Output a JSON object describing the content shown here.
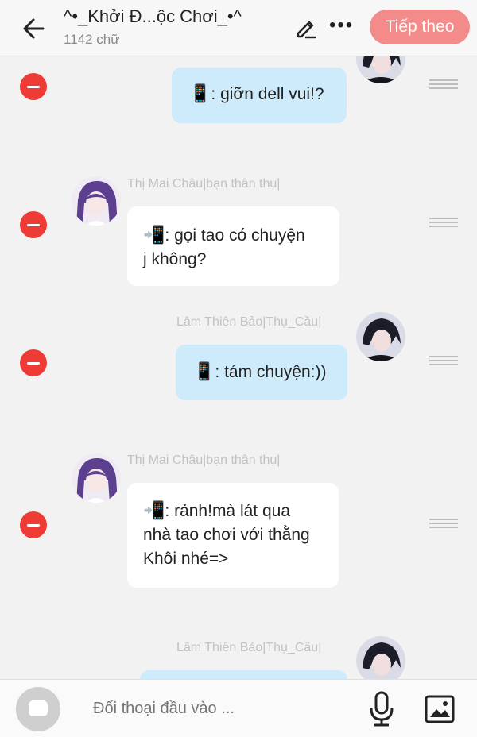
{
  "header": {
    "title": "^•_Khởi Đ...ộc Chơi_•^",
    "word_count": "1142 chữ",
    "next_button": "Tiếp theo"
  },
  "messages": [
    {
      "sender": "",
      "side": "me",
      "text": ": giỡn dell vui!?"
    },
    {
      "sender": "Thị Mai Châu|bạn thân thụ|",
      "side": "other",
      "text_line1": ": gọi tao có chuyện",
      "text_line2": "j không?"
    },
    {
      "sender": "Lâm Thiên Bảo|Thụ_Cầu|",
      "side": "me",
      "text": ": tám chuyện:))"
    },
    {
      "sender": "Thị Mai Châu|bạn thân thụ|",
      "side": "other",
      "text_line1": ": rảnh!mà lát qua",
      "text_line2": "nhà tao chơi với thằng",
      "text_line3": "Khôi nhé=>"
    },
    {
      "sender": "Lâm Thiên Bảo|Thụ_Cầu|",
      "side": "me",
      "text": ""
    }
  ],
  "composer": {
    "placeholder": "Đối thoại đầu vào ..."
  },
  "colors": {
    "accent": "#f48b8b",
    "remove": "#ef3b36",
    "my_bubble": "#cdebfa",
    "other_bubble": "#ffffff"
  }
}
